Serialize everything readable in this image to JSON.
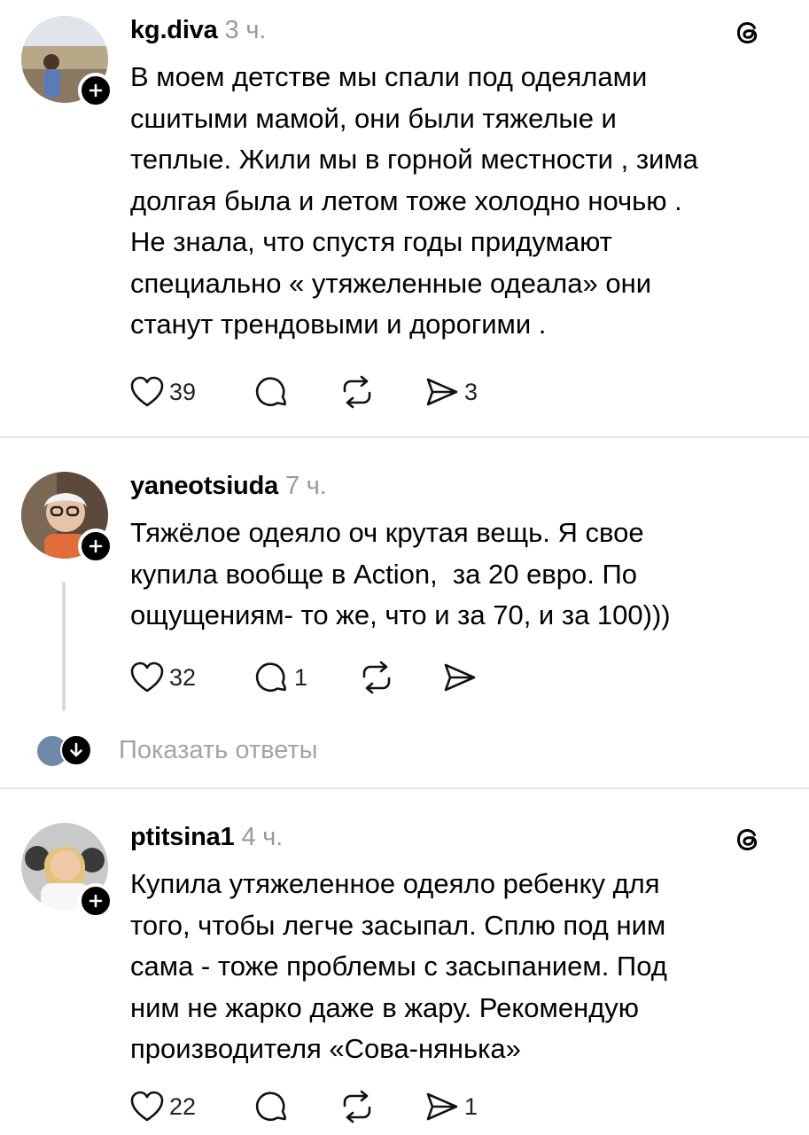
{
  "posts": [
    {
      "username": "kg.diva",
      "time": "3 ч.",
      "text": "В моем детстве мы спали под одеялами\nсшитыми мамой, они были тяжелые и\nтеплые. Жили мы в горной местности , зима\nдолгая была и летом тоже холодно ночью .\nНе знала, что спустя годы придумают\nспециально « утяжеленные одеала» они\nстанут трендовыми и дорогими .",
      "likes": "39",
      "replies": "",
      "reposts": "",
      "shares": "3",
      "icons": [
        "heart-icon",
        "comment-icon",
        "repost-icon",
        "share-icon",
        "threads-logo-icon"
      ]
    },
    {
      "username": "yaneotsiuda",
      "time": "7 ч.",
      "text": "Тяжёлое одеяло оч крутая вещь. Я свое\nкупила вообще в Action,  за 20 евро. По\nощущениям- то же, что и за 70, и за 100)))",
      "likes": "32",
      "replies": "1",
      "reposts": "",
      "shares": ""
    },
    {
      "username": "ptitsina1",
      "time": "4 ч.",
      "text": "Купила утяжеленное одеяло ребенку для\nтого, чтобы легче засыпал. Сплю под ним\nсама - тоже проблемы с засыпанием. Под\nним не жарко даже в жару. Рекомендую\nпроизводителя «Сова-нянька»",
      "likes": "22",
      "replies": "",
      "reposts": "",
      "shares": "1"
    }
  ],
  "show_replies": {
    "label": "Показать ответы",
    "icon": "arrow-down-icon"
  },
  "colors": {
    "text": "#000000",
    "muted": "#9a9a9a",
    "divider": "#e4e4e4",
    "background": "#ffffff"
  }
}
